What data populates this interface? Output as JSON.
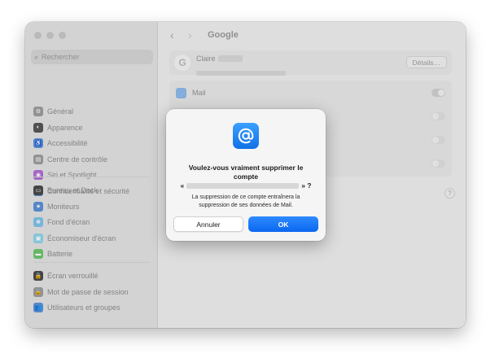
{
  "window": {
    "title": "Google",
    "accent_color": "#0a67f0"
  },
  "sidebar": {
    "search_placeholder": "Rechercher",
    "groups": [
      [
        {
          "label": "Général",
          "icon": "gear-icon",
          "color": "#9c9c9c",
          "glyph": "⚙"
        },
        {
          "label": "Apparence",
          "icon": "appearance-icon",
          "color": "#555555",
          "glyph": "◐"
        },
        {
          "label": "Accessibilité",
          "icon": "accessibility-icon",
          "color": "#5b8fd6",
          "glyph": "♿"
        },
        {
          "label": "Centre de contrôle",
          "icon": "control-center-icon",
          "color": "#9c9c9c",
          "glyph": "▤"
        },
        {
          "label": "Siri et Spotlight",
          "icon": "siri-icon",
          "color": "#b06cd4",
          "glyph": "◉"
        },
        {
          "label": "Confidentialité et sécurité",
          "icon": "privacy-hand-icon",
          "color": "#5b8fd6",
          "glyph": "✋"
        }
      ],
      [
        {
          "label": "Bureau et Dock",
          "icon": "dock-icon",
          "color": "#4a4a4a",
          "glyph": "▭"
        },
        {
          "label": "Moniteurs",
          "icon": "display-icon",
          "color": "#5b8fd6",
          "glyph": "✷"
        },
        {
          "label": "Fond d'écran",
          "icon": "wallpaper-icon",
          "color": "#7ec1e6",
          "glyph": "❋"
        },
        {
          "label": "Économiseur d'écran",
          "icon": "screensaver-icon",
          "color": "#8fd2e6",
          "glyph": "▣"
        },
        {
          "label": "Batterie",
          "icon": "battery-icon",
          "color": "#6cc46c",
          "glyph": "▬"
        }
      ],
      [
        {
          "label": "Écran verrouillé",
          "icon": "lock-screen-icon",
          "color": "#4a4a4a",
          "glyph": "🔒"
        },
        {
          "label": "Mot de passe de session",
          "icon": "password-icon",
          "color": "#9c9c9c",
          "glyph": "🔒"
        },
        {
          "label": "Utilisateurs et groupes",
          "icon": "users-icon",
          "color": "#5b8fd6",
          "glyph": "👥"
        }
      ]
    ]
  },
  "account": {
    "name": "Claire",
    "details_button": "Détails…"
  },
  "apps": [
    {
      "label": "Mail",
      "toggle": true
    },
    {
      "label": "",
      "toggle": false
    },
    {
      "label": "",
      "toggle": false
    },
    {
      "label": "",
      "toggle": false
    }
  ],
  "dialog": {
    "title": "Voulez-vous vraiment supprimer le compte",
    "open_quote": "«",
    "close_quote": "» ?",
    "message": "La suppression de ce compte entraînera la suppression de ses données de Mail.",
    "cancel_label": "Annuler",
    "ok_label": "OK"
  },
  "help_label": "?"
}
